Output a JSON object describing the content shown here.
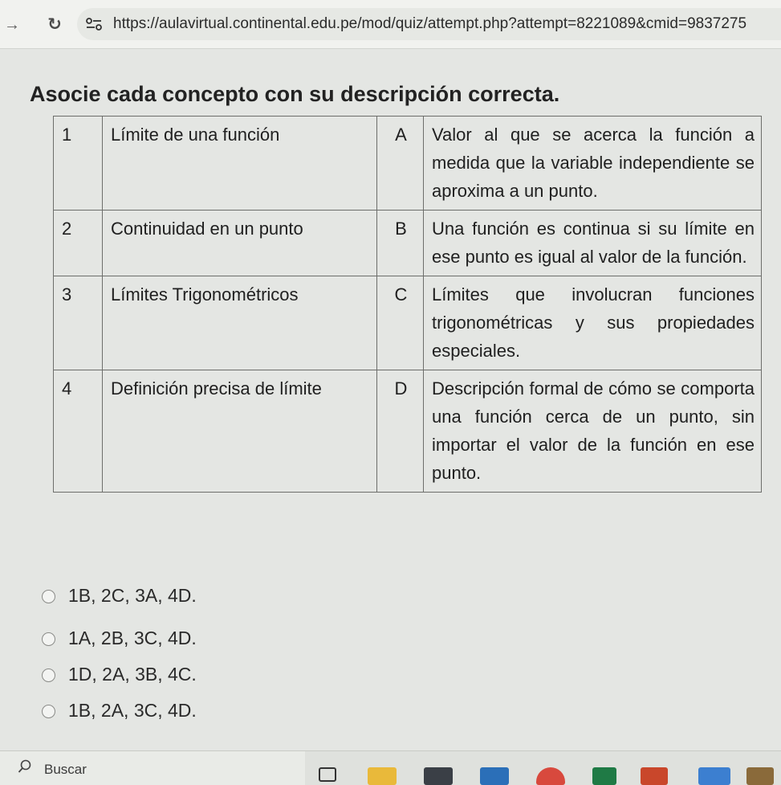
{
  "browser": {
    "url": "https://aulavirtual.continental.edu.pe/mod/quiz/attempt.php?attempt=8221089&cmid=9837275"
  },
  "question": {
    "title": "Asocie cada concepto con su descripción correcta.",
    "rows": [
      {
        "num": "1",
        "concept": "Límite de una función",
        "letter": "A",
        "description": "Valor al que se acerca la función a medida que la variable independiente se aproxima a un punto."
      },
      {
        "num": "2",
        "concept": "Continuidad en un punto",
        "letter": "B",
        "description": "Una función es continua si su límite en ese punto es igual al valor de la función."
      },
      {
        "num": "3",
        "concept": "Límites Trigonométricos",
        "letter": "C",
        "description": "Límites que involucran funciones trigonométricas y sus propiedades especiales."
      },
      {
        "num": "4",
        "concept": "Definición precisa de límite",
        "letter": "D",
        "description": "Descripción formal de cómo se comporta una función cerca de un punto, sin importar el valor de la función en ese punto."
      }
    ]
  },
  "options": [
    {
      "label": "1B, 2C, 3A, 4D."
    },
    {
      "label": "1A, 2B, 3C, 4D."
    },
    {
      "label": "1D, 2A, 3B, 4C."
    },
    {
      "label": "1B, 2A, 3C, 4D."
    }
  ],
  "taskbar": {
    "search_placeholder": "Buscar"
  },
  "colors": {
    "page_bg": "#e4e6e3",
    "table_border": "#6d6e6b",
    "text": "#202020"
  }
}
